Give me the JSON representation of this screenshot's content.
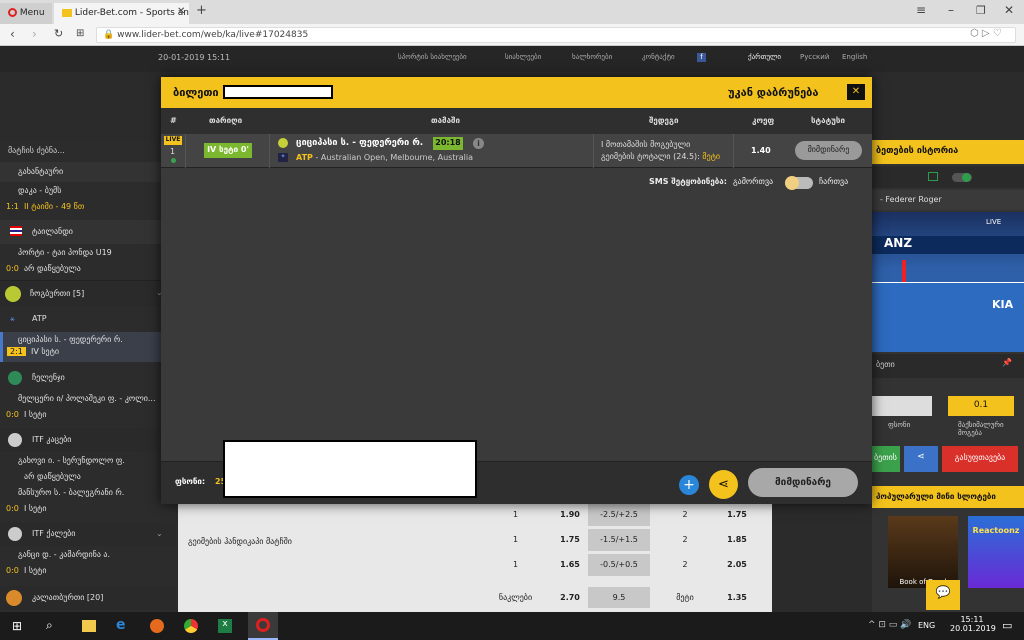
{
  "browser": {
    "menu_label": "Menu",
    "tab_title": "Lider-Bet.com - Sports and",
    "url": "www.lider-bet.com/web/ka/live#17024835"
  },
  "site": {
    "datetime": "20-01-2019 15:11",
    "nav": [
      "სპორტის სიახლეები",
      "სიახლეები",
      "ხალხორები",
      "კონტაქტი"
    ],
    "langs": [
      "ქართული",
      "Русский",
      "English"
    ]
  },
  "left_panel": {
    "search_label": "მატჩის ძებნა...",
    "items": [
      {
        "type": "group",
        "label": "გახანტაური"
      },
      {
        "type": "match",
        "label": "დაკა - ბუმს"
      },
      {
        "type": "score",
        "score": "1:1",
        "period": "II ტაიმი - 49 წთ"
      },
      {
        "type": "group",
        "label": "ტაილანდი"
      },
      {
        "type": "match",
        "label": "პორტი - ტაი პონდა U19"
      },
      {
        "type": "score",
        "score": "0:0",
        "period": "არ დაწყებულა"
      },
      {
        "type": "sport",
        "label": "ჩოგბურთი [5]"
      },
      {
        "type": "group",
        "label": "ATP"
      },
      {
        "type": "match",
        "label": "ციციპასი ს. - ფედერერი რ."
      },
      {
        "type": "score",
        "score": "2:1",
        "period": "IV სეტი"
      },
      {
        "type": "group",
        "label": "ჩელენჯი"
      },
      {
        "type": "match",
        "label": "მელცერი ი/ პოლაშეკი ფ. - კოლი..."
      },
      {
        "type": "score",
        "score": "0:0",
        "period": "I სეტი"
      },
      {
        "type": "group",
        "label": "ITF კაცები"
      },
      {
        "type": "match",
        "label": "გახოვი ი. - სერუნდოლო ფ."
      },
      {
        "type": "score",
        "score": "",
        "period": "არ დაწყებულა"
      },
      {
        "type": "match",
        "label": "მანსურო ს. - ბალეგრანი რ."
      },
      {
        "type": "score",
        "score": "0:0",
        "period": "I სეტი"
      },
      {
        "type": "group",
        "label": "ITF ქალები"
      },
      {
        "type": "match",
        "label": "განცი დ. - კამარდინა ა."
      },
      {
        "type": "score",
        "score": "0:0",
        "period": "I სეტი"
      },
      {
        "type": "sport",
        "label": "კალათბურთი [20]"
      }
    ]
  },
  "right_panel": {
    "history_title": "ბეთების ისტორია",
    "stream_label": "- Federer Roger",
    "live_badge": "LIVE",
    "ad_text": "ANZ",
    "kia_text": "KIA",
    "field_left_value": "",
    "field_right_value": "0.1",
    "field_left_label": "ფსონი",
    "field_right_label": "მაქსიმალური მოგება",
    "bet_button": "ბეთის",
    "clear_button": "გასუფთავება",
    "slots_title": "პოპულარული მინი სლოტები",
    "slots": [
      "Book of Dead",
      "Reactoonz"
    ]
  },
  "modal": {
    "title": "ბილეთი",
    "back_label": "უკან დაბრუნება",
    "columns": [
      "#",
      "თარიღი",
      "თამაში",
      "შედეგი",
      "კოეფ",
      "სტატუსი"
    ],
    "row": {
      "live": "LIVE",
      "index": "1",
      "period": "IV სეტი 0'",
      "match": "ციციპასი ს. - ფედერერი რ.",
      "time": "20:18",
      "league_code": "ATP",
      "tournament": "- Australian Open, Melbourne, Australia",
      "market": "I მოთამაშის მოგებული",
      "market2": "გეიმების ტოტალი (24.5):",
      "pick": "მეტი",
      "odds": "1.40",
      "status": "მიმდინარე"
    },
    "sms_label": "SMS შეტყობინება:",
    "sms_off": "გამორთვა",
    "sms_on": "ჩართვა",
    "stake_label": "ფსონი:",
    "stake_value": "25",
    "status_button": "მიმდინარე"
  },
  "center_lower": {
    "market_label": "გეიმების ჰანდიკაპი მატჩში",
    "rows": [
      [
        "1",
        "1.90",
        "-2.5/+2.5",
        "2",
        "1.75"
      ],
      [
        "1",
        "1.75",
        "-1.5/+1.5",
        "2",
        "1.85"
      ],
      [
        "1",
        "1.65",
        "-0.5/+0.5",
        "2",
        "2.05"
      ],
      [
        "ნაკლები",
        "2.70",
        "9.5",
        "მეტი",
        "1.35"
      ]
    ]
  },
  "taskbar": {
    "lang": "ENG",
    "time": "15:11",
    "date": "20.01.2019"
  }
}
